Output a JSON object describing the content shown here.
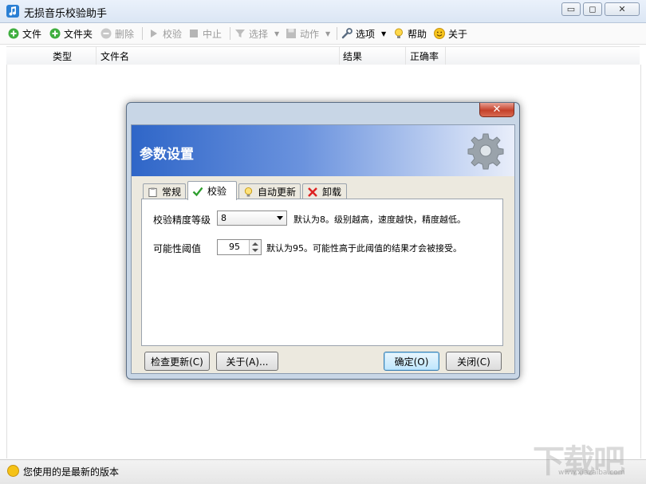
{
  "window": {
    "title": "无损音乐校验助手",
    "controls": {
      "minimize": "▭",
      "restore": "◻",
      "close": "✕"
    }
  },
  "toolbar": {
    "file": "文件",
    "folder": "文件夹",
    "delete": "删除",
    "verify": "校验",
    "stop": "中止",
    "select": "选择",
    "action": "动作",
    "options": "选项",
    "help": "帮助",
    "about": "关于"
  },
  "list": {
    "columns": [
      "类型",
      "文件名",
      "结果",
      "正确率"
    ]
  },
  "dialog": {
    "title": "参数设置",
    "close_symbol": "✕",
    "tabs": [
      "常规",
      "校验",
      "自动更新",
      "卸载"
    ],
    "active_tab": "校验",
    "precision": {
      "label": "校验精度等级",
      "value": "8",
      "hint": "默认为8。级别越高，速度越快，精度越低。"
    },
    "threshold": {
      "label": "可能性阈值",
      "value": "95",
      "hint": "默认为95。可能性高于此阈值的结果才会被接受。"
    },
    "buttons": {
      "check_update": "检查更新(C)",
      "about": "关于(A)...",
      "ok": "确定(O)",
      "close": "关闭(C)"
    }
  },
  "status": {
    "text": "您使用的是最新的版本"
  },
  "watermark": {
    "text": "下载吧",
    "url": "www.xiazaiba.com"
  },
  "colors": {
    "banner_start": "#2f66c8",
    "banner_end": "#e9eefa",
    "ok_button": "#bee6fd",
    "dialog_close": "#c4412a"
  }
}
